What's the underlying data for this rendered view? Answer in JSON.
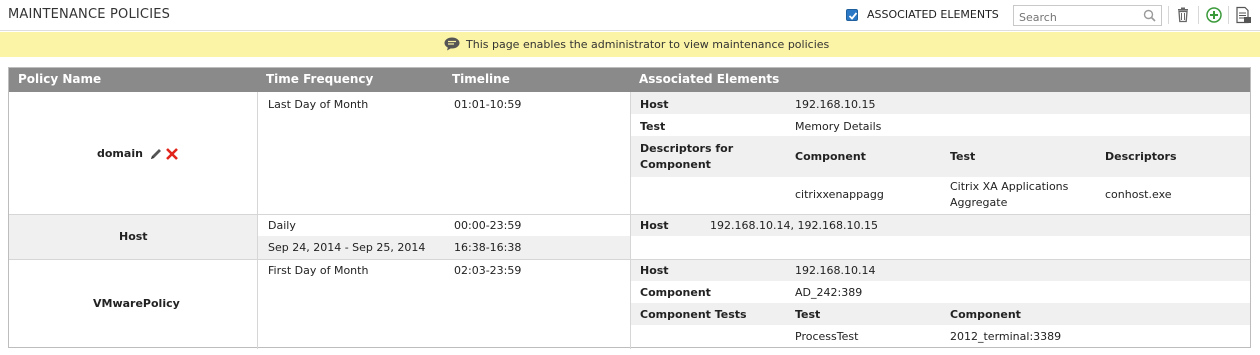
{
  "header": {
    "title": "MAINTENANCE POLICIES",
    "associated_elements_label": "ASSOCIATED ELEMENTS",
    "associated_elements_checked": true,
    "search_placeholder": "Search",
    "icons": [
      "delete-icon",
      "add-icon",
      "export-icon"
    ]
  },
  "info_bar": {
    "text": "This page enables the administrator to view maintenance policies"
  },
  "table": {
    "columns": {
      "policy_name": "Policy Name",
      "time_frequency": "Time Frequency",
      "timeline": "Timeline",
      "associated_elements": "Associated Elements"
    },
    "rows": [
      {
        "policy": "domain",
        "schedules": [
          {
            "frequency": "Last Day of Month",
            "timeline": "01:01-10:59"
          }
        ],
        "assoc": {
          "host_label": "Host",
          "host_value": "192.168.10.15",
          "test_label": "Test",
          "test_value": "Memory Details",
          "dfc_label": "Descriptors for Component",
          "dfc_cols": [
            "Component",
            "Test",
            "Descriptors"
          ],
          "dfc_values": [
            "citrixxenappagg",
            "Citrix XA Applications Aggregate",
            "conhost.exe"
          ]
        }
      },
      {
        "policy": "Host",
        "schedules": [
          {
            "frequency": "Daily",
            "timeline": "00:00-23:59"
          },
          {
            "frequency": "Sep 24, 2014 - Sep 25, 2014",
            "timeline": "16:38-16:38"
          }
        ],
        "assoc": {
          "host_label": "Host",
          "host_value": "192.168.10.14, 192.168.10.15"
        }
      },
      {
        "policy": "VMwarePolicy",
        "schedules": [
          {
            "frequency": "First Day of Month",
            "timeline": "02:03-23:59"
          }
        ],
        "assoc": {
          "host_label": "Host",
          "host_value": "192.168.10.14",
          "component_label": "Component",
          "component_value": "AD_242:389",
          "ct_label": "Component Tests",
          "ct_cols": [
            "Test",
            "Component"
          ],
          "ct_values": [
            "ProcessTest",
            "2012_terminal:3389"
          ]
        }
      }
    ]
  }
}
